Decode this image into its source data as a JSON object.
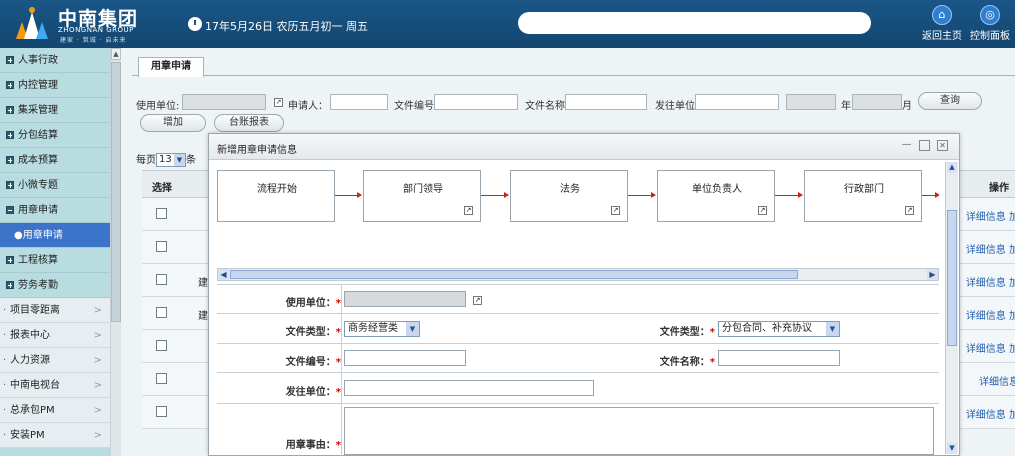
{
  "header": {
    "brand_cn": "中南集团",
    "brand_en": "ZHONGNAN GROUP",
    "slogan": "建家 · 筑城 · 启未来",
    "date": "17年5月26日 农历五月初一 周五",
    "home_label": "返回主页",
    "control_label": "控制面板",
    "colors": {
      "bar": "#1a5687",
      "accent": "#2f7ed0"
    }
  },
  "sidebar": {
    "groups": [
      {
        "label": "人事行政"
      },
      {
        "label": "内控管理"
      },
      {
        "label": "集采管理"
      },
      {
        "label": "分包结算"
      },
      {
        "label": "成本预算"
      },
      {
        "label": "小微专题"
      },
      {
        "label": "用章申请"
      },
      {
        "label": "工程核算"
      },
      {
        "label": "劳务考勤"
      }
    ],
    "active_sub": "●用章申请",
    "modules": [
      {
        "label": "项目零距离"
      },
      {
        "label": "报表中心"
      },
      {
        "label": "人力资源"
      },
      {
        "label": "中南电视台"
      },
      {
        "label": "总承包PM"
      },
      {
        "label": "安装PM"
      }
    ],
    "chevron": ">"
  },
  "main": {
    "tab": "用章申请",
    "filter": {
      "unit_label": "使用单位:",
      "applicant_label": "申请人：",
      "doc_no_label": "文件编号:",
      "doc_name_label": "文件名称:",
      "issue_unit_label": "发往单位:",
      "year_label": "年",
      "month_label": "月",
      "query_button": "查询",
      "add_button": "增加",
      "ledger_button": "台账报表"
    },
    "pager": {
      "prefix": "每页",
      "size": "13",
      "suffix": "条"
    },
    "grid": {
      "select_header": "选择",
      "op_header": "操作",
      "rows": [
        {
          "prefix": "",
          "op": "详细信息 加"
        },
        {
          "prefix": "",
          "op": "详细信息 加"
        },
        {
          "prefix": "建",
          "op": "详细信息 加"
        },
        {
          "prefix": "建",
          "op": "详细信息 加"
        },
        {
          "prefix": "",
          "op": "详细信息 加"
        },
        {
          "prefix": "",
          "op": "详细信息"
        },
        {
          "prefix": "",
          "op": "详细信息 加"
        }
      ]
    }
  },
  "modal": {
    "title": "新增用章申请信息",
    "controls": {
      "minimize": "—",
      "maximize": "☐",
      "close": "✕"
    },
    "flow": [
      {
        "label": "流程开始"
      },
      {
        "label": "部门领导"
      },
      {
        "label": "法务"
      },
      {
        "label": "单位负责人"
      },
      {
        "label": "行政部门"
      }
    ],
    "form": {
      "unit_label": "使用单位：",
      "doc_type_label": "文件类型：",
      "doc_type_value": "商务经营类",
      "doc_type2_label": "文件类型：",
      "doc_type2_value": "分包合同、补充协议",
      "doc_no_label": "文件编号：",
      "doc_name_label": "文件名称：",
      "issue_unit_label": "发往单位：",
      "reason_label": "用章事由：",
      "required_mark": "*"
    }
  }
}
